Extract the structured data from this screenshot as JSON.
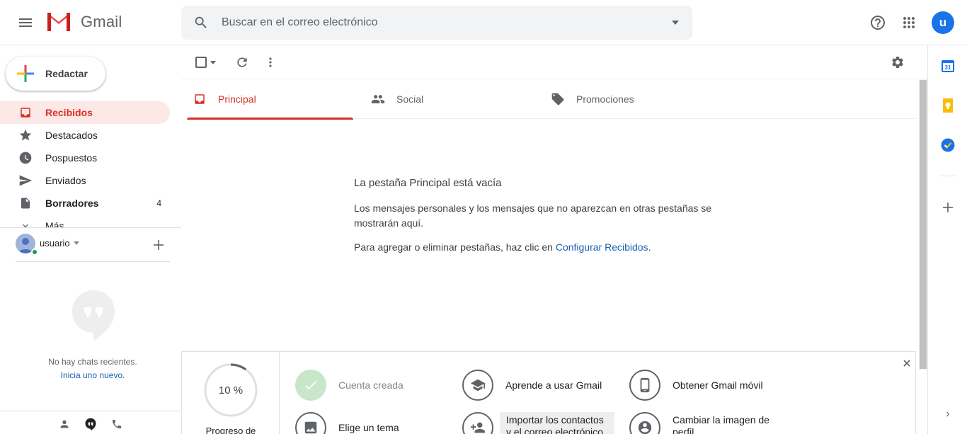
{
  "header": {
    "app_name": "Gmail",
    "search_placeholder": "Buscar en el correo electrónico",
    "avatar_letter": "u"
  },
  "compose": {
    "label": "Redactar"
  },
  "nav": {
    "items": [
      {
        "label": "Recibidos",
        "icon": "inbox-icon",
        "active": true
      },
      {
        "label": "Destacados",
        "icon": "star-icon"
      },
      {
        "label": "Pospuestos",
        "icon": "clock-icon"
      },
      {
        "label": "Enviados",
        "icon": "send-icon"
      },
      {
        "label": "Borradores",
        "icon": "draft-icon",
        "count": "4",
        "bold": true
      },
      {
        "label": "Más",
        "icon": "chevron-down-icon"
      }
    ]
  },
  "hangouts": {
    "user_name": "usuario",
    "no_chats": "No hay chats recientes.",
    "start_new": "Inicia uno nuevo."
  },
  "tabs": [
    {
      "label": "Principal",
      "icon": "inbox-icon",
      "active": true
    },
    {
      "label": "Social",
      "icon": "people-icon"
    },
    {
      "label": "Promociones",
      "icon": "tag-icon"
    }
  ],
  "empty": {
    "title": "La pestaña Principal está vacía",
    "description": "Los mensajes personales y los mensajes que no aparezcan en otras pestañas se mostrarán aquí.",
    "hint_prefix": "Para agregar o eliminar pestañas, haz clic en ",
    "hint_link": "Configurar Recibidos",
    "hint_suffix": "."
  },
  "onboarding": {
    "progress_value": 10,
    "progress_text": "10 %",
    "progress_label": "Progreso de",
    "items": [
      {
        "label": "Cuenta creada",
        "icon": "check-icon",
        "done": true
      },
      {
        "label": "Aprende a usar Gmail",
        "icon": "school-icon"
      },
      {
        "label": "Obtener Gmail móvil",
        "icon": "phone-icon"
      },
      {
        "label": "Elige un tema",
        "icon": "image-icon"
      },
      {
        "label": "Importar los contactos y el correo electrónico",
        "icon": "add-person-icon"
      },
      {
        "label": "Cambiar la imagen de perfil",
        "icon": "account-icon"
      }
    ]
  },
  "colors": {
    "accent_red": "#d93025",
    "link_blue": "#1a5fb4",
    "active_bg": "#fce8e6",
    "avatar_blue": "#1a73e8",
    "done_green": "#c8e6c9"
  }
}
